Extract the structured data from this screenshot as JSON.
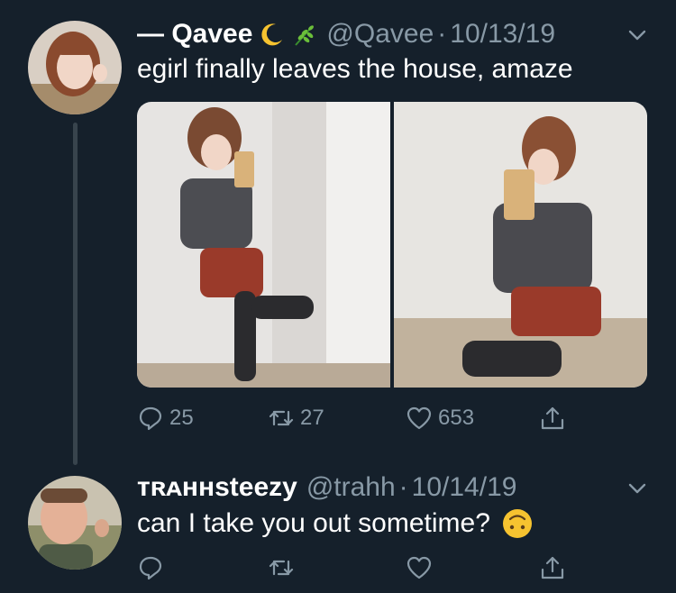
{
  "tweets": [
    {
      "display_name": "— Qavee",
      "handle": "@Qavee",
      "separator": "·",
      "date": "10/13/19",
      "text": "egirl finally leaves the house, amaze",
      "replies": "25",
      "retweets": "27",
      "likes": "653",
      "photos": 2
    },
    {
      "display_name": "ᴛʀᴀʜʜsteezy",
      "handle": "@trahh",
      "separator": "·",
      "date": "10/14/19",
      "text": "can I take you out sometime?"
    }
  ],
  "icons": {
    "reply": "reply-icon",
    "retweet": "retweet-icon",
    "like": "heart-icon",
    "share": "share-icon",
    "caret": "chevron-down-icon"
  },
  "colors": {
    "background": "#15202b",
    "secondary_text": "#8899a6",
    "thread_line": "#38444d"
  }
}
